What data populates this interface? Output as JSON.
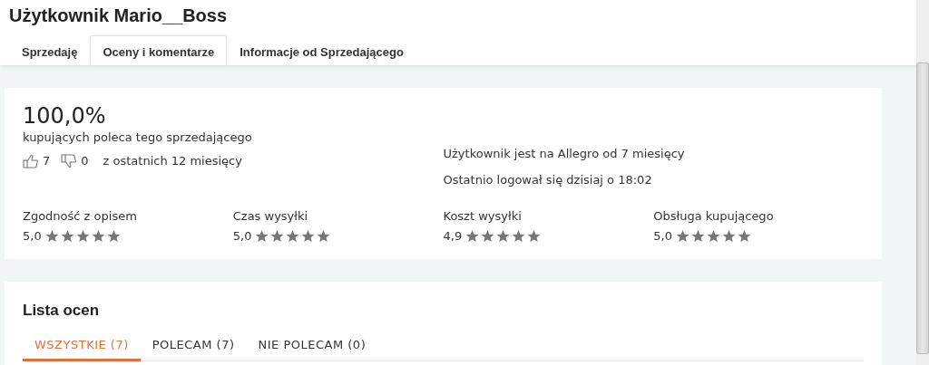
{
  "title": "Użytkownik Mario__Boss",
  "tabs": [
    {
      "label": "Sprzedaję",
      "selected": false
    },
    {
      "label": "Oceny i komentarze",
      "selected": true
    },
    {
      "label": "Informacje od Sprzedającego",
      "selected": false
    }
  ],
  "summary": {
    "percent": "100,0%",
    "percent_caption": "kupujących poleca tego sprzedającego",
    "positive_count": "7",
    "negative_count": "0",
    "period": "z ostatnich 12 miesięcy",
    "member_since": "Użytkownik jest na Allegro od 7 miesięcy",
    "last_login": "Ostatnio logował się dzisiaj o 18:02"
  },
  "ratings": [
    {
      "label": "Zgodność z opisem",
      "value": "5,0",
      "stars": 5
    },
    {
      "label": "Czas wysyłki",
      "value": "5,0",
      "stars": 5
    },
    {
      "label": "Koszt wysyłki",
      "value": "4,9",
      "stars": 5
    },
    {
      "label": "Obsługa kupującego",
      "value": "5,0",
      "stars": 5
    }
  ],
  "list": {
    "title": "Lista ocen",
    "filters": [
      {
        "label": "WSZYSTKIE (7)",
        "selected": true
      },
      {
        "label": "POLECAM (7)",
        "selected": false
      },
      {
        "label": "NIE POLECAM (0)",
        "selected": false
      }
    ]
  }
}
